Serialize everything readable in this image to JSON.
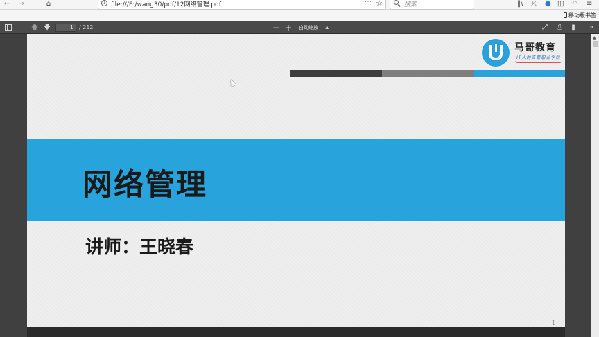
{
  "browser": {
    "url": "file:///E:/wang30/pdf/12网络管理.pdf",
    "search_placeholder": "搜索",
    "bookmark_label": "移动版书签"
  },
  "pdf_toolbar": {
    "page_number": "1",
    "page_count": "/ 212",
    "zoom": "自动缩放"
  },
  "slide": {
    "logo_name": "马哥教育",
    "logo_slogan": "IT人的高薪职业学院",
    "title": "网络管理",
    "lecturer": "讲师：王晓春",
    "page_number": "1"
  },
  "colors": {
    "banner": "#29a3dc",
    "stripe_dark": "#3d3d3d",
    "stripe_gray": "#7e7e7e",
    "stripe_blue": "#29a3dc"
  }
}
